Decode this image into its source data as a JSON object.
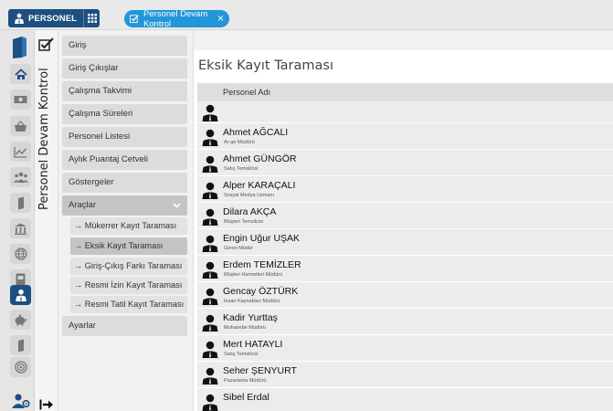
{
  "header": {
    "module_label": "PERSONEL",
    "active_tab": "Personel Devam Kontrol"
  },
  "sidebar_title": "Personel Devam Kontrol",
  "menu": {
    "items": [
      {
        "label": "Giriş"
      },
      {
        "label": "Giriş Çıkışlar"
      },
      {
        "label": "Çalışma Takvimi"
      },
      {
        "label": "Çalışma Süreleri"
      },
      {
        "label": "Personel Listesi"
      },
      {
        "label": "Aylık Puantaj Cetveli"
      },
      {
        "label": "Göstergeler"
      },
      {
        "label": "Araçlar"
      },
      {
        "label": "Ayarlar"
      }
    ],
    "subitems": [
      {
        "label": "→ Mükerrer Kayıt Taraması"
      },
      {
        "label": "→ Eksik Kayıt Taraması"
      },
      {
        "label": "→ Giriş-Çıkış Farkı Taraması"
      },
      {
        "label": "→ Resmi İzin Kayıt Taraması"
      },
      {
        "label": "→ Resmi Tatil Kayıt Taraması"
      }
    ],
    "active_subitem": "→ Eksik Kayıt Taraması"
  },
  "page": {
    "title": "Eksik Kayıt Taraması",
    "column_header": "Personel Adı"
  },
  "rows": [
    {
      "name": "",
      "title": ""
    },
    {
      "name": "Ahmet AĞCALI",
      "title": "Ar-ge Müdürü"
    },
    {
      "name": "Ahmet GÜNGÖR",
      "title": "Satış Temsilcisi"
    },
    {
      "name": "Alper KARAÇALI",
      "title": "Sosyal Medya Uzmanı"
    },
    {
      "name": "Dilara AKÇA",
      "title": "Müşteri Temsilcisi"
    },
    {
      "name": "Engin Uğur UŞAK",
      "title": "Genel Müdür"
    },
    {
      "name": "Erdem TEMİZLER",
      "title": "Müşteri Hizmetleri Müdürü"
    },
    {
      "name": "Gencay ÖZTÜRK",
      "title": "İnsan Kaynakları Müdürü"
    },
    {
      "name": "Kadir Yurttaş",
      "title": "Muhasebe Müdürü"
    },
    {
      "name": "Mert HATAYLI",
      "title": "Satış Temsilcisi"
    },
    {
      "name": "Seher ŞENYURT",
      "title": "Pazarlama Müdürü"
    },
    {
      "name": "Sibel Erdal",
      "title": ""
    }
  ],
  "rail_icons": [
    "home-icon",
    "money-icon",
    "basket-icon",
    "chart-icon",
    "group-icon",
    "book-icon",
    "bank-icon",
    "globe-icon",
    "device-icon",
    "personnel-icon",
    "piggy-bank-icon",
    "book2-icon",
    "target-icon",
    "user-settings-icon"
  ],
  "colors": {
    "accent": "#1d4f80",
    "tab_pill": "#2196d8",
    "menu_item": "#dcdcdc",
    "menu_active": "#c4c4c4",
    "row_bg": "#ececec"
  }
}
